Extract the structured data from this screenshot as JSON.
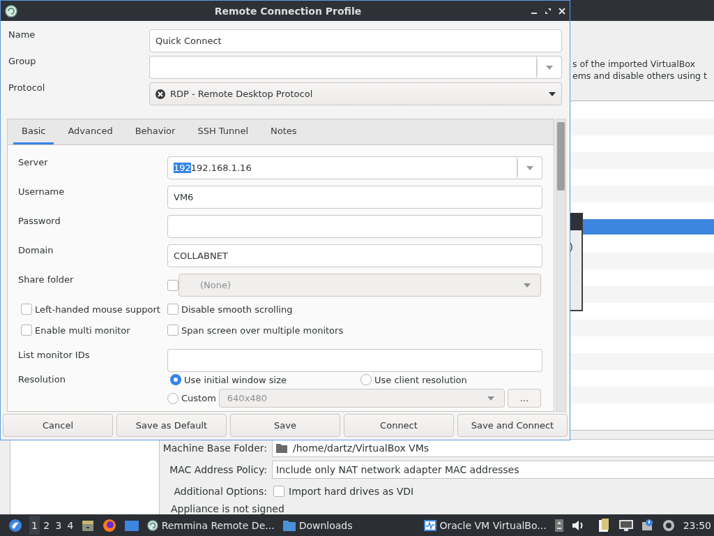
{
  "background_window": {
    "description_lines": [
      "s of the imported VirtualBox",
      "ems and disable others using t"
    ],
    "list_rows": [
      {
        "selected": false
      },
      {
        "selected": false
      },
      {
        "selected": false
      },
      {
        "selected": false
      },
      {
        "selected": false
      },
      {
        "selected": false
      },
      {
        "selected": false
      },
      {
        "selected": true
      },
      {
        "selected": false
      },
      {
        "selected": false
      },
      {
        "selected": false
      },
      {
        "selected": false
      },
      {
        "selected": false
      },
      {
        "selected": false
      },
      {
        "selected": false
      },
      {
        "selected": false
      },
      {
        "selected": false
      },
      {
        "selected": false
      },
      {
        "selected": false
      }
    ],
    "popup": {
      "text": ")"
    },
    "form": [
      {
        "label": "Machine Base Folder:",
        "value": "/home/dartz/VirtualBox VMs",
        "kind": "folder"
      },
      {
        "label": "MAC Address Policy:",
        "value": "Include only NAT network adapter MAC addresses",
        "kind": "combo"
      },
      {
        "label": "Additional Options:",
        "value": "Import hard drives as VDI",
        "kind": "checkbox",
        "checked": false
      }
    ],
    "status_text": "Appliance is not signed"
  },
  "dialog": {
    "title": "Remote Connection Profile",
    "fields": [
      {
        "label": "Name",
        "value": "Quick Connect",
        "kind": "entry"
      },
      {
        "label": "Group",
        "kind": "combo-entry"
      },
      {
        "label": "Protocol",
        "value": "RDP - Remote Desktop Protocol",
        "kind": "combo"
      }
    ],
    "tabs": [
      {
        "label": "Basic",
        "selected": true
      },
      {
        "label": "Advanced",
        "selected": false
      },
      {
        "label": "Behavior",
        "selected": false
      },
      {
        "label": "SSH Tunnel",
        "selected": false
      },
      {
        "label": "Notes",
        "selected": false
      }
    ],
    "server": {
      "label": "Server",
      "selection": "192",
      "value": "192.168.1.16"
    },
    "basic_fields": [
      {
        "label": "Username",
        "value": "VM6"
      },
      {
        "label": "Password"
      },
      {
        "label": "Domain",
        "value": "COLLABNET"
      }
    ],
    "share_folder": {
      "label": "Share folder",
      "checked": false,
      "value": "(None)",
      "disabled": true
    },
    "options": [
      {
        "label": "Left-handed mouse support",
        "checked": false
      },
      {
        "label": "Disable smooth scrolling",
        "checked": false
      },
      {
        "label": "Enable multi monitor",
        "checked": false
      },
      {
        "label": "Span screen over multiple monitors",
        "checked": false
      }
    ],
    "monitor_ids": {
      "label": "List monitor IDs"
    },
    "resolution": {
      "label": "Resolution",
      "options": [
        {
          "label": "Use initial window size",
          "selected": true
        },
        {
          "label": "Use client resolution",
          "selected": false
        },
        {
          "label": "Custom",
          "selected": false
        }
      ],
      "custom_size": "640x480",
      "custom_disabled": true,
      "custom_button": "..."
    },
    "buttons": [
      "Cancel",
      "Save as Default",
      "Save",
      "Connect",
      "Save and Connect"
    ]
  },
  "taskbar": {
    "workspaces": [
      {
        "label": "1",
        "selected": true
      },
      {
        "label": "2",
        "selected": false
      },
      {
        "label": "3",
        "selected": false
      },
      {
        "label": "4",
        "selected": false
      }
    ],
    "tasks": [
      {
        "label": "Remmina Remote De...",
        "kind": "app"
      },
      {
        "label": "Downloads",
        "kind": "folder"
      },
      {
        "label": "Oracle VM VirtualBo...",
        "kind": "monitor"
      }
    ],
    "clock": "23:50"
  }
}
